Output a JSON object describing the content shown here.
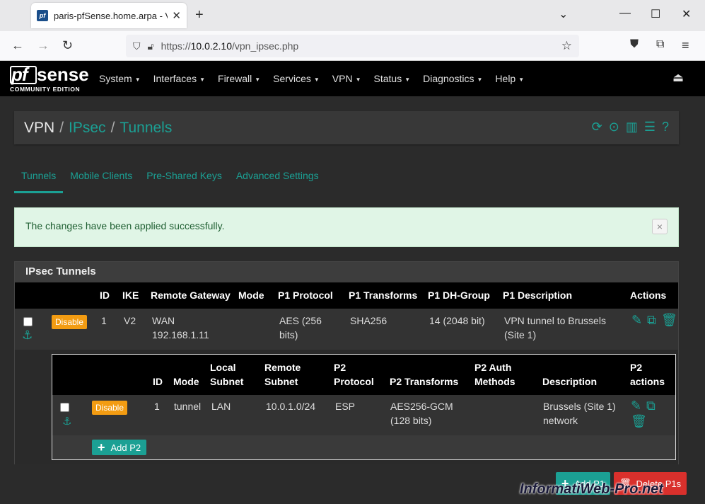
{
  "browser": {
    "tab_title": "paris-pfSense.home.arpa - VPN",
    "url_scheme": "https://",
    "url_host": "10.0.2.10",
    "url_path": "/vpn_ipsec.php"
  },
  "brand": {
    "logo_pf": "pf",
    "logo_sense": "sense",
    "logo_sub": "COMMUNITY EDITION"
  },
  "nav": {
    "items": [
      {
        "label": "System"
      },
      {
        "label": "Interfaces"
      },
      {
        "label": "Firewall"
      },
      {
        "label": "Services"
      },
      {
        "label": "VPN"
      },
      {
        "label": "Status"
      },
      {
        "label": "Diagnostics"
      },
      {
        "label": "Help"
      }
    ]
  },
  "breadcrumb": {
    "root": "VPN",
    "level1": "IPsec",
    "level2": "Tunnels"
  },
  "tabs": [
    {
      "label": "Tunnels",
      "active": true
    },
    {
      "label": "Mobile Clients"
    },
    {
      "label": "Pre-Shared Keys"
    },
    {
      "label": "Advanced Settings"
    }
  ],
  "alert": {
    "message": "The changes have been applied successfully.",
    "close": "×"
  },
  "panel": {
    "title": "IPsec Tunnels",
    "p1_headers": {
      "id": "ID",
      "ike": "IKE",
      "gateway": "Remote Gateway",
      "mode": "Mode",
      "protocol": "P1 Protocol",
      "transforms": "P1 Transforms",
      "dhgroup": "P1 DH-Group",
      "description": "P1 Description",
      "actions": "Actions"
    },
    "p1_row": {
      "disable": "Disable",
      "id": "1",
      "ike": "V2",
      "gateway_line1": "WAN",
      "gateway_line2": "192.168.1.11",
      "protocol_line1": "AES (256",
      "protocol_line2": "bits)",
      "transforms": "SHA256",
      "dhgroup": "14 (2048 bit)",
      "description_line1": "VPN tunnel to Brussels",
      "description_line2": "(Site 1)"
    },
    "p2_headers": {
      "id": "ID",
      "mode": "Mode",
      "local_1": "Local",
      "local_2": "Subnet",
      "remote_1": "Remote",
      "remote_2": "Subnet",
      "protocol_1": "P2",
      "protocol_2": "Protocol",
      "transforms": "P2 Transforms",
      "auth_1": "P2 Auth",
      "auth_2": "Methods",
      "description": "Description",
      "actions_1": "P2",
      "actions_2": "actions"
    },
    "p2_row": {
      "disable": "Disable",
      "id": "1",
      "mode": "tunnel",
      "local": "LAN",
      "remote": "10.0.1.0/24",
      "protocol": "ESP",
      "transforms_line1": "AES256-GCM",
      "transforms_line2": "(128 bits)",
      "description_line1": "Brussels (Site 1)",
      "description_line2": "network"
    },
    "add_p2": "Add P2"
  },
  "footer_buttons": {
    "add_p1": "Add P1",
    "delete_p1s": "Delete P1s"
  },
  "watermark": "InformatiWeb-Pro.net",
  "colors": {
    "accent": "#1ba094",
    "warning": "#f39c12",
    "danger": "#d9302c"
  }
}
